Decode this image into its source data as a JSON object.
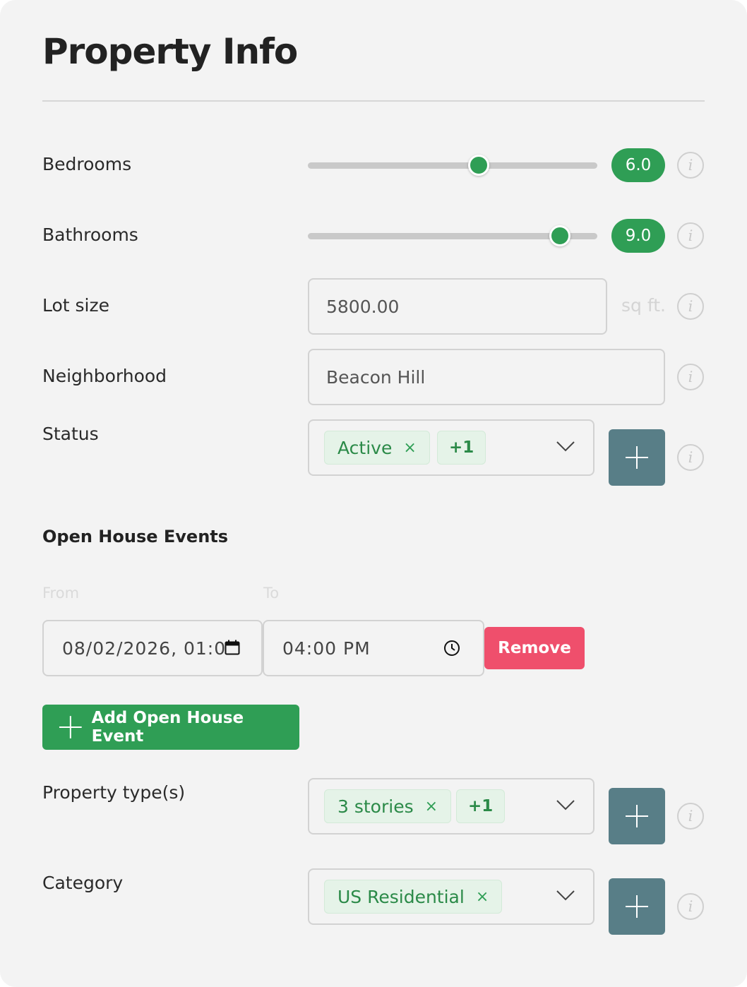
{
  "header": {
    "title": "Property Info"
  },
  "bedrooms": {
    "label": "Bedrooms",
    "value": "6.0",
    "fraction": 0.59
  },
  "bathrooms": {
    "label": "Bathrooms",
    "value": "9.0",
    "fraction": 0.87
  },
  "lot_size": {
    "label": "Lot size",
    "value": "5800.00",
    "unit": "sq ft."
  },
  "neighborhood": {
    "label": "Neighborhood",
    "value": "Beacon Hill"
  },
  "status": {
    "label": "Status",
    "chip": "Active",
    "more": "+1"
  },
  "open_house": {
    "heading": "Open House Events",
    "from_label": "From",
    "to_label": "To",
    "from_value": "08/02/2026, 01:0",
    "to_value": "04:00  PM",
    "remove_label": "Remove",
    "add_label": "Add Open House Event"
  },
  "property_type": {
    "label": "Property type(s)",
    "chip": "3 stories",
    "more": "+1"
  },
  "category": {
    "label": "Category",
    "chip": "US Residential"
  },
  "common": {
    "remove_glyph": "×",
    "info_glyph": "i"
  },
  "colors": {
    "accent": "#2f9e55",
    "add_button": "#587e87",
    "remove": "#ef4f6c"
  }
}
